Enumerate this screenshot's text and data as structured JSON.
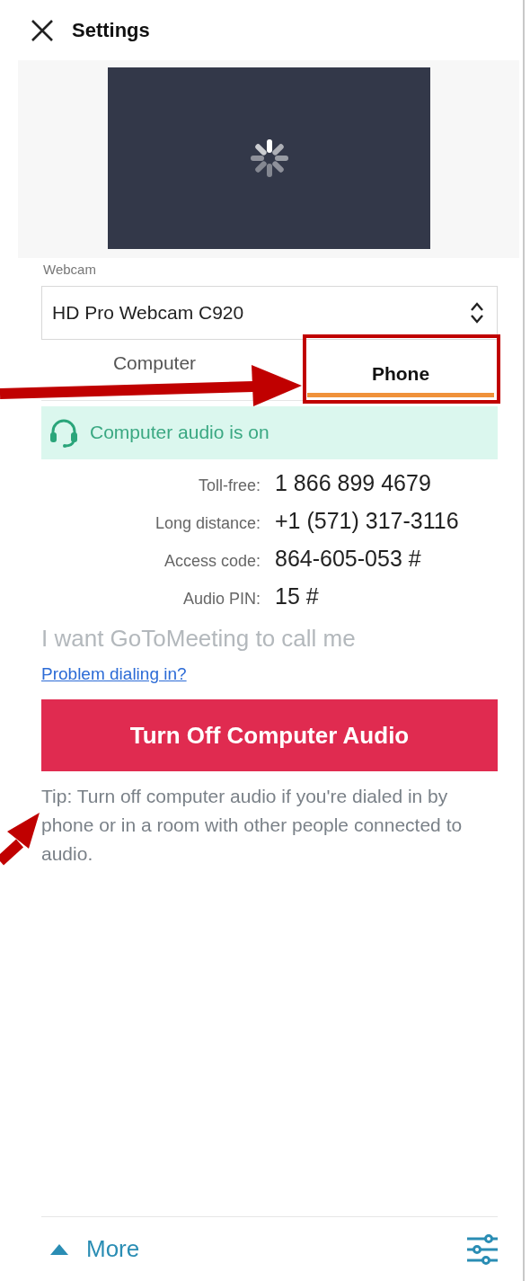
{
  "header": {
    "title": "Settings"
  },
  "webcam": {
    "label": "Webcam",
    "value": "HD Pro Webcam C920"
  },
  "tabs": [
    {
      "label": "Computer",
      "selected": false
    },
    {
      "label": "Phone",
      "selected": true
    }
  ],
  "status": {
    "text": "Computer audio is on"
  },
  "dial_in": [
    {
      "label": "Toll-free:",
      "value": "1 866 899 4679"
    },
    {
      "label": "Long distance:",
      "value": "+1 (571) 317-3116"
    },
    {
      "label": "Access code:",
      "value": "864-605-053 #"
    },
    {
      "label": "Audio PIN:",
      "value": "15 #"
    }
  ],
  "call_me": {
    "text": "I want GoToMeeting to call me",
    "disabled": true
  },
  "help_link": "Problem dialing in?",
  "primary_button": "Turn Off Computer Audio",
  "tip": "Tip: Turn off computer audio if you're dialed in by phone or in a room with other people connected to audio.",
  "footer": {
    "more": "More"
  },
  "annotations": [
    {
      "kind": "arrow"
    },
    {
      "kind": "box"
    },
    {
      "kind": "arrow"
    }
  ]
}
